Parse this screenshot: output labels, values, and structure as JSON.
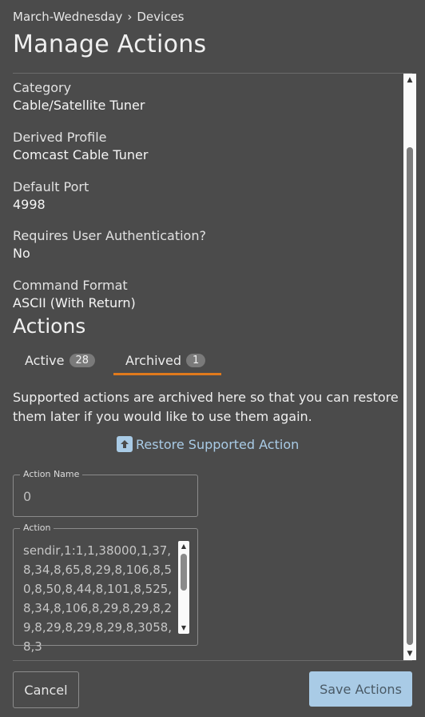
{
  "breadcrumb": {
    "parent": "March-Wednesday",
    "separator": "›",
    "current": "Devices"
  },
  "page_title": "Manage Actions",
  "fields": [
    {
      "label": "Category",
      "value": "Cable/Satellite Tuner"
    },
    {
      "label": "Derived Profile",
      "value": "Comcast Cable Tuner"
    },
    {
      "label": "Default Port",
      "value": "4998"
    },
    {
      "label": "Requires User Authentication?",
      "value": "No"
    },
    {
      "label": "Command Format",
      "value": "ASCII (With Return)"
    }
  ],
  "actions_section": {
    "title": "Actions",
    "tabs": [
      {
        "label": "Active",
        "count": "28",
        "selected": false
      },
      {
        "label": "Archived",
        "count": "1",
        "selected": true
      }
    ],
    "accent_color": "#e07a1c",
    "help_text": "Supported actions are archived here so that you can restore them later if you would like to use them again.",
    "restore_label": "Restore Supported Action",
    "restore_icon": "restore-upload-icon"
  },
  "form": {
    "action_name_label": "Action Name",
    "action_name_value": "0",
    "action_label": "Action",
    "action_value": "sendir,1:1,1,38000,1,37,8,34,8,65,8,29,8,106,8,50,8,50,8,44,8,101,8,525,8,34,8,106,8,29,8,29,8,29,8,29,8,29,8,29,8,3058,8,3"
  },
  "buttons": {
    "cancel": "Cancel",
    "save": "Save Actions"
  }
}
